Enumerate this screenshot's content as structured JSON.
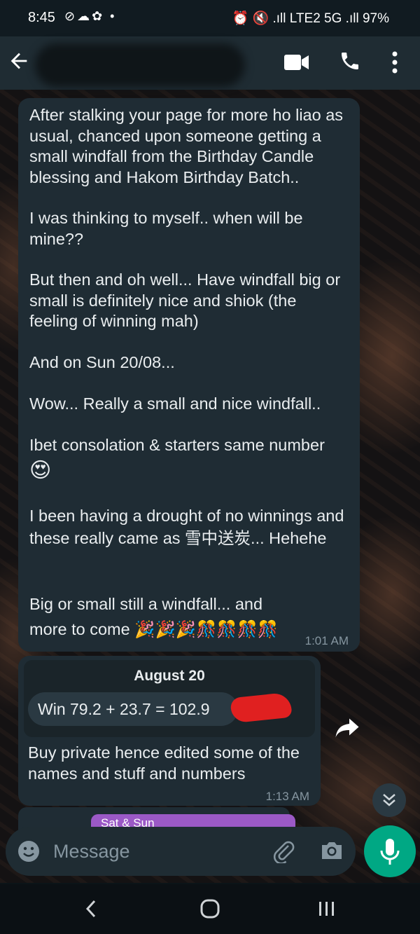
{
  "status_bar": {
    "time": "8:45",
    "left_icons": "⊘☁✿ •",
    "right_text": "⏰ 🔇 .ıll LTE2 5G .ıll 97%",
    "battery": "97%"
  },
  "header": {
    "contact_name": "",
    "icons": [
      "back-arrow-icon",
      "video-call-icon",
      "phone-icon",
      "more-options-icon"
    ]
  },
  "messages": [
    {
      "paragraphs": [
        "After stalking your page for more ho liao as usual, chanced upon someone getting a small windfall from the Birthday Candle blessing and Hakom Birthday Batch..",
        "I was thinking to myself.. when will be mine??",
        "But then and oh well... Have windfall big or small is definitely nice and shiok (the feeling of winning mah)",
        "And on Sun 20/08...",
        "Wow... Really a small and nice windfall..",
        "Ibet consolation & starters same number",
        "😍",
        "I been having a drought of no winnings and these really came as 雪中送炭... Hehehe",
        "Big or small still a windfall... and more to come 🎉🎉🎉🎊🎊🎊🎊"
      ],
      "time": "1:01 AM"
    },
    {
      "quoted": {
        "date": "August 20",
        "win_line": "Win 79.2 + 23.7 = 102.9"
      },
      "text": "Buy private hence edited some of the names and stuff and numbers",
      "time": "1:13 AM"
    }
  ],
  "partial_next": {
    "pill": "Sat & Sun"
  },
  "input": {
    "placeholder": "Message"
  },
  "colors": {
    "accent": "#00a884",
    "bubble": "#1f2c34",
    "header": "#1f2c33",
    "redaction": "#e02020"
  }
}
